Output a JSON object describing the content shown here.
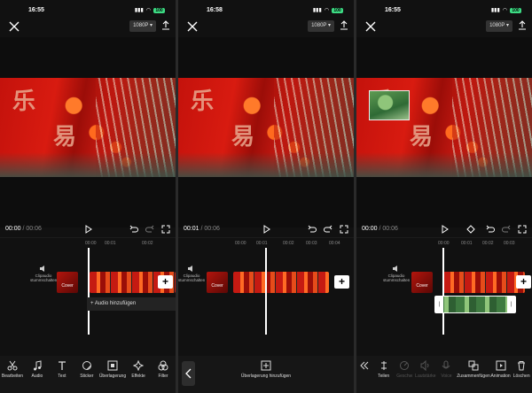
{
  "panels": [
    {
      "status_time": "16:55",
      "resolution": "1080P",
      "time_current": "00:00",
      "time_total": " / 00:06",
      "ruler": [
        "00:00",
        "00:01",
        "00:02"
      ],
      "mute_label": "Clipaudio stummschalten",
      "cover_label": "Cover",
      "add_audio": "+ Audio hinzufügen",
      "tools": [
        "Bearbeiten",
        "Audio",
        "Text",
        "Sticker",
        "Überlagerung",
        "Effekte",
        "Filter"
      ]
    },
    {
      "status_time": "16:58",
      "resolution": "1080P",
      "time_current": "00:01",
      "time_total": " / 00:06",
      "ruler": [
        "00:00",
        "00:01",
        "00:02",
        "00:03",
        "00:04"
      ],
      "mute_label": "Clipaudio stummschalten",
      "cover_label": "Cover",
      "overlay_add": "Überlagerung hinzufügen"
    },
    {
      "status_time": "16:55",
      "resolution": "1080P",
      "time_current": "00:00",
      "time_total": " / 00:06",
      "ruler": [
        "00:00",
        "00:01",
        "00:02",
        "00:03"
      ],
      "mute_label": "Clipaudio stummschalten",
      "cover_label": "Cover",
      "tools": [
        "Teilen",
        "Geschw",
        "Lautstärke",
        "Voice",
        "Zusammenfügen",
        "Animation",
        "Löschen"
      ]
    }
  ],
  "battery": "100",
  "accent": "#3ddc84"
}
